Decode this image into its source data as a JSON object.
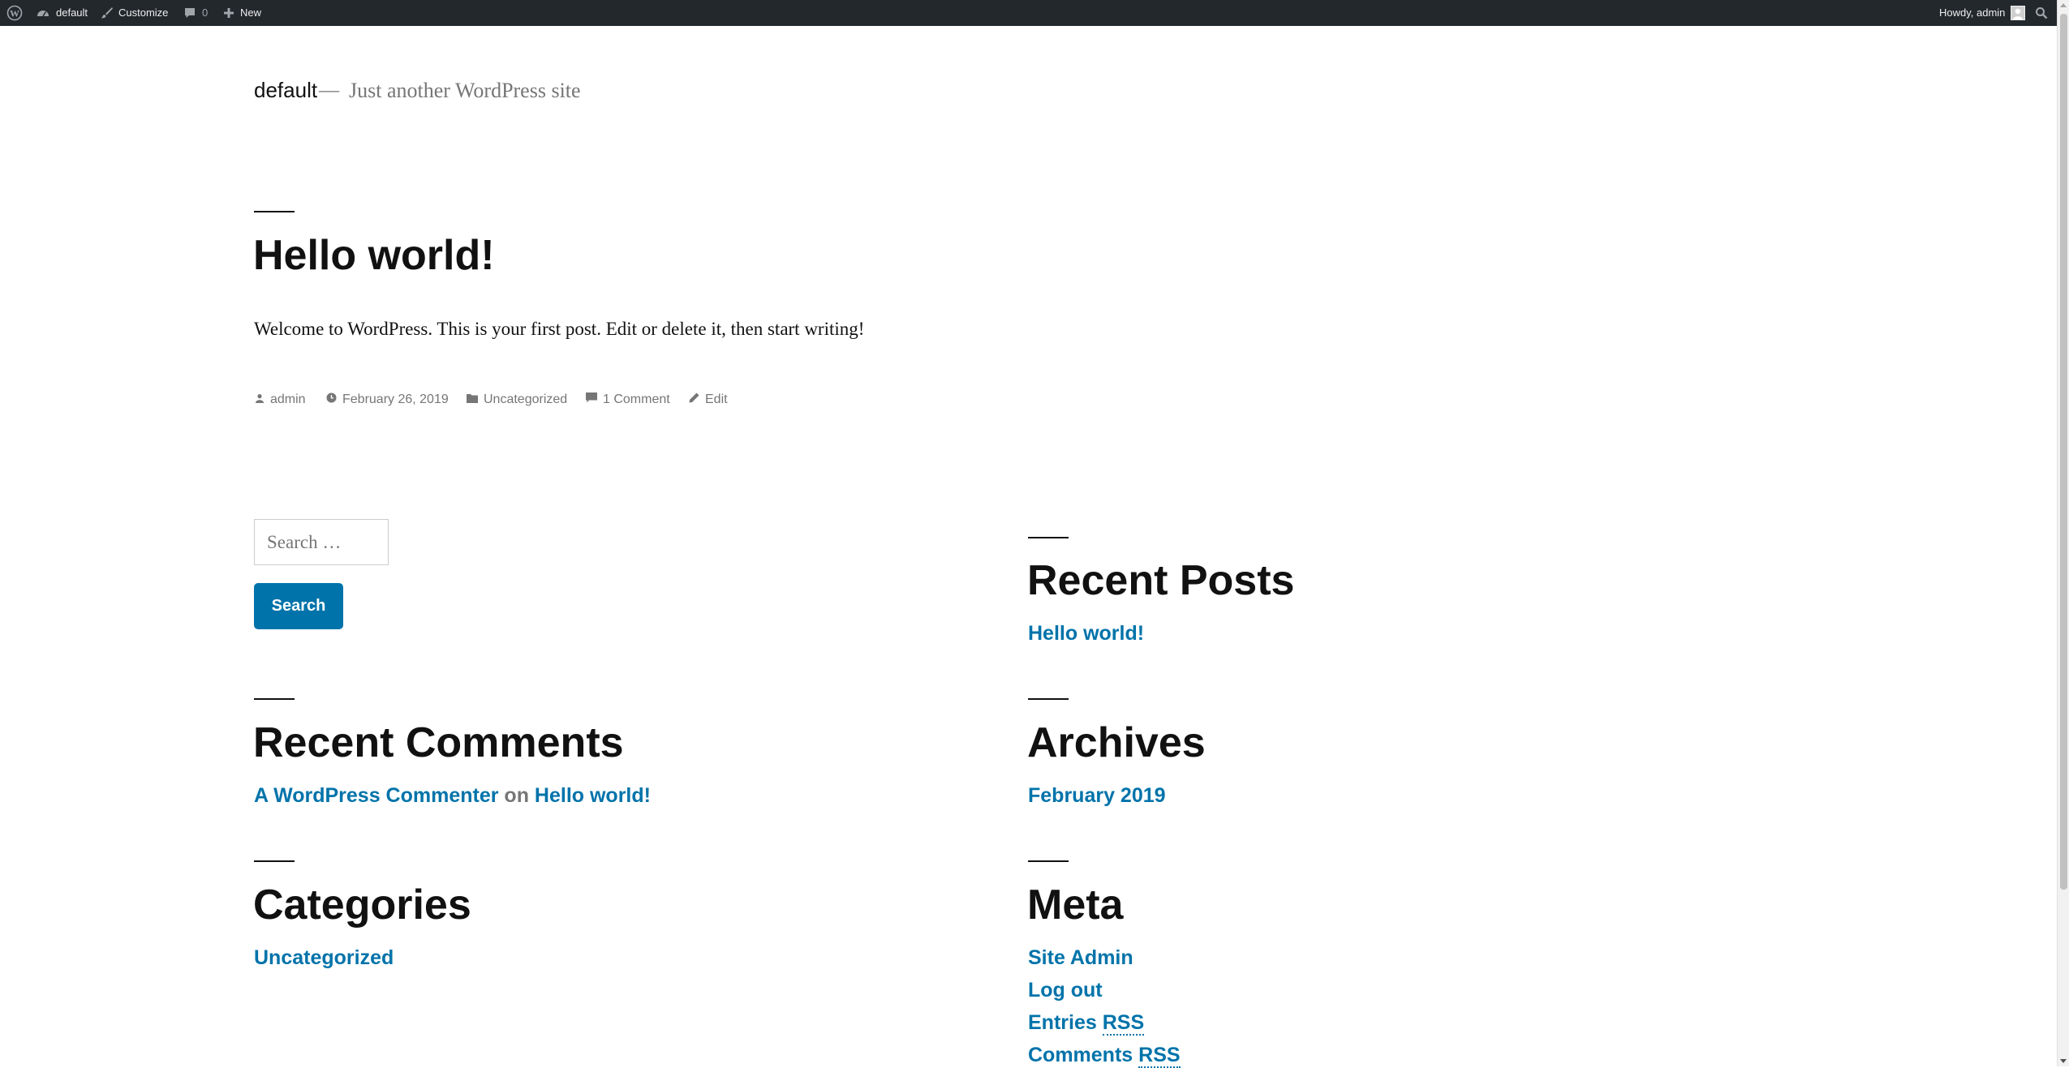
{
  "admin_bar": {
    "site_name": "default",
    "customize_label": "Customize",
    "comments_count": "0",
    "new_label": "New",
    "howdy": "Howdy, admin"
  },
  "site": {
    "title": "default",
    "separator": "—",
    "description": "Just another WordPress site"
  },
  "post": {
    "title": "Hello world!",
    "content": "Welcome to WordPress. This is your first post. Edit or delete it, then start writing!",
    "meta": {
      "author": "admin",
      "date": "February 26, 2019",
      "category": "Uncategorized",
      "comments": "1 Comment",
      "edit": "Edit"
    }
  },
  "search": {
    "placeholder": "Search …",
    "button_label": "Search"
  },
  "widgets": {
    "recent_posts": {
      "title": "Recent Posts",
      "items": [
        "Hello world!"
      ]
    },
    "recent_comments": {
      "title": "Recent Comments",
      "author": "A WordPress Commenter",
      "on": "on",
      "post": "Hello world!"
    },
    "archives": {
      "title": "Archives",
      "items": [
        "February 2019"
      ]
    },
    "categories": {
      "title": "Categories",
      "items": [
        "Uncategorized"
      ]
    },
    "meta": {
      "title": "Meta",
      "site_admin": "Site Admin",
      "log_out": "Log out",
      "entries_prefix": "Entries",
      "comments_prefix": "Comments",
      "rss": "RSS"
    }
  },
  "colors": {
    "admin_bar_bg": "#23282d",
    "link": "#0073aa",
    "muted": "#767676",
    "text": "#111111"
  }
}
